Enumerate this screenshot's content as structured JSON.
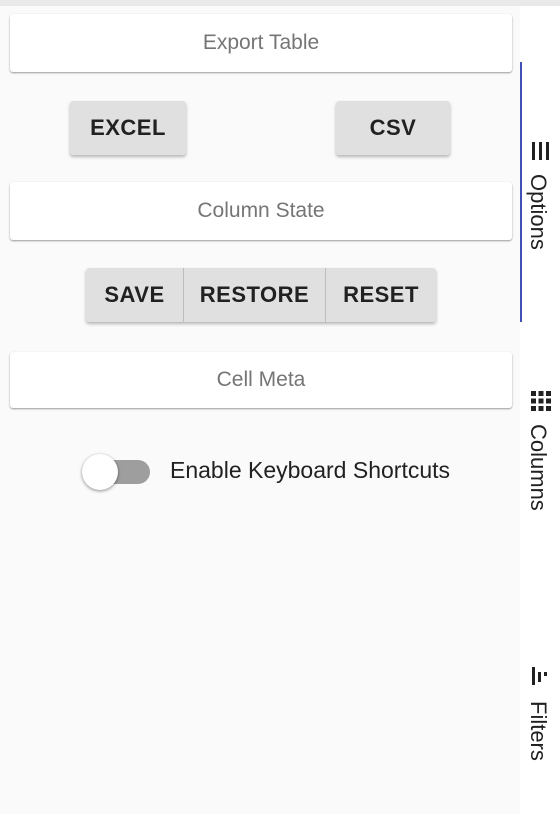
{
  "export": {
    "header": "Export Table",
    "excel_label": "EXCEL",
    "csv_label": "CSV"
  },
  "column_state": {
    "header": "Column State",
    "save_label": "SAVE",
    "restore_label": "RESTORE",
    "reset_label": "RESET"
  },
  "cell_meta": {
    "header": "Cell Meta",
    "toggle_label": "Enable Keyboard Shortcuts",
    "toggle_on": false
  },
  "sidebar": {
    "tabs": [
      {
        "label": "Options",
        "icon": "menu-icon",
        "active": true
      },
      {
        "label": "Columns",
        "icon": "grid-icon",
        "active": false
      },
      {
        "label": "Filters",
        "icon": "filter-icon",
        "active": false
      }
    ]
  },
  "colors": {
    "accent": "#3f51b5",
    "button_bg": "#e0e0e0",
    "toggle_track": "#9e9e9e"
  }
}
